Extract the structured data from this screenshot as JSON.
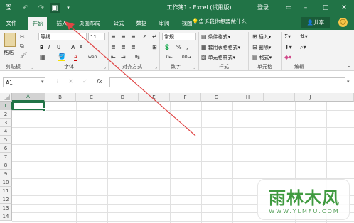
{
  "app": {
    "window_title": "工作簿1 - Excel (试用版)",
    "login": "登录"
  },
  "tabs": [
    {
      "label": "文件"
    },
    {
      "label": "开始"
    },
    {
      "label": "插入"
    },
    {
      "label": "页面布局"
    },
    {
      "label": "公式"
    },
    {
      "label": "数据"
    },
    {
      "label": "审阅"
    },
    {
      "label": "视图"
    }
  ],
  "tellme": "告诉我你想要做什么",
  "share": "共享",
  "ribbon": {
    "clipboard": {
      "paste": "粘贴",
      "label": "剪贴板"
    },
    "font": {
      "name": "等线",
      "size": "11",
      "bold": "B",
      "italic": "I",
      "underline": "U",
      "grow": "A",
      "shrink": "A",
      "color_letter": "A",
      "phonetic": "wén",
      "label": "字体"
    },
    "alignment": {
      "label": "对齐方式"
    },
    "number": {
      "format": "常规",
      "label": "数字"
    },
    "styles": {
      "conditional": "条件格式",
      "table": "套用表格格式",
      "cell": "单元格样式",
      "label": "样式"
    },
    "cells": {
      "insert": "插入",
      "delete": "删除",
      "format": "格式",
      "label": "单元格"
    },
    "editing": {
      "label": "编辑"
    }
  },
  "formula_bar": {
    "name_box": "A1",
    "cancel": "✕",
    "enter": "✓",
    "fx": "fx"
  },
  "columns": [
    "A",
    "B",
    "C",
    "D",
    "E",
    "F",
    "G",
    "H",
    "I",
    "J"
  ],
  "rows": [
    "1",
    "2",
    "3",
    "4",
    "5",
    "6",
    "7",
    "8",
    "9",
    "10",
    "11",
    "12",
    "13",
    "14"
  ],
  "watermark": {
    "title": "雨林木风",
    "url": "WWW.YLMFU.COM"
  },
  "colors": {
    "accent": "#217346",
    "annotation_arrow": "#e04545"
  }
}
